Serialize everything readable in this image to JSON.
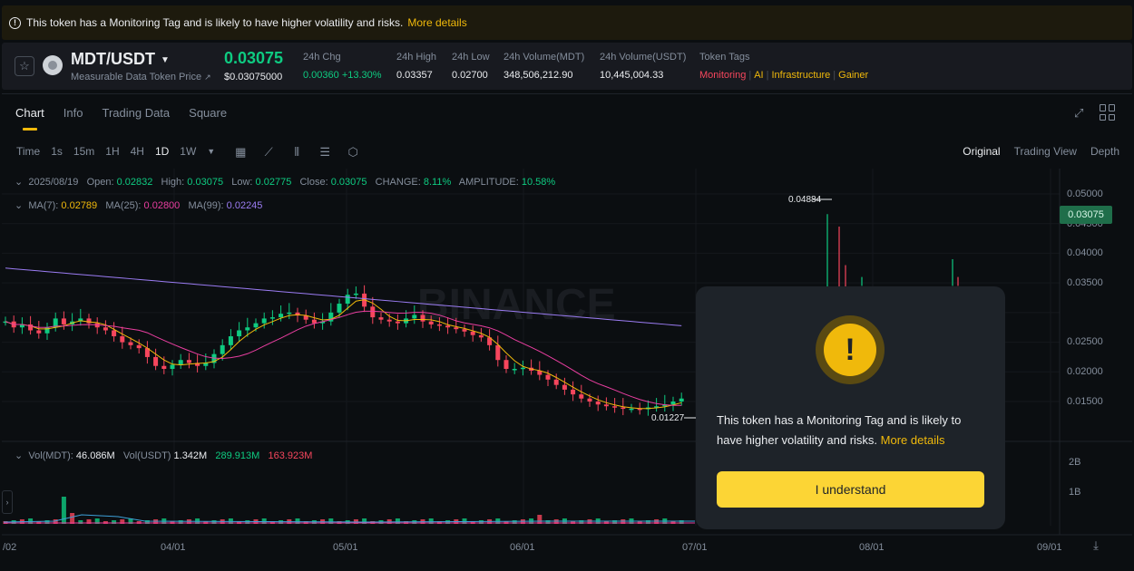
{
  "banner": {
    "icon": "info-icon",
    "text": "This token has a Monitoring Tag and is likely to have higher volatility and risks.",
    "link": "More details"
  },
  "header": {
    "pair": "MDT/USDT",
    "pair_name": "Measurable Data Token Price",
    "price": "0.03075",
    "price_usd": "$0.03075000",
    "stats": [
      {
        "key": "24h Chg",
        "value": "0.00360 +13.30%",
        "up": true
      },
      {
        "key": "24h High",
        "value": "0.03357",
        "up": false
      },
      {
        "key": "24h Low",
        "value": "0.02700",
        "up": false
      },
      {
        "key": "24h Volume(MDT)",
        "value": "348,506,212.90",
        "up": false
      },
      {
        "key": "24h Volume(USDT)",
        "value": "10,445,004.33",
        "up": false
      }
    ],
    "tags_label": "Token Tags",
    "tags": [
      "Monitoring",
      "AI",
      "Infrastructure",
      "Gainer"
    ]
  },
  "tabs": [
    "Chart",
    "Info",
    "Trading Data",
    "Square"
  ],
  "toolbar": {
    "intervals": [
      "Time",
      "1s",
      "15m",
      "1H",
      "4H",
      "1D",
      "1W"
    ],
    "active": "1D",
    "views": [
      "Original",
      "Trading View",
      "Depth"
    ]
  },
  "ohlc": {
    "date": "2025/08/19",
    "open_label": "Open:",
    "open": "0.02832",
    "high_label": "High:",
    "high": "0.03075",
    "low_label": "Low:",
    "low": "0.02775",
    "close_label": "Close:",
    "close": "0.03075",
    "change_label": "CHANGE:",
    "change": "8.11%",
    "amp_label": "AMPLITUDE:",
    "amp": "10.58%"
  },
  "ma": {
    "ma7_label": "MA(7):",
    "ma7": "0.02789",
    "ma25_label": "MA(25):",
    "ma25": "0.02800",
    "ma99_label": "MA(99):",
    "ma99": "0.02245"
  },
  "vol": {
    "mdt_label": "Vol(MDT):",
    "mdt": "46.086M",
    "usdt_label": "Vol(USDT)",
    "usdt": "1.342M",
    "ma1": "289.913M",
    "ma2": "163.923M"
  },
  "chart_data": {
    "type": "candlestick",
    "y_ticks": [
      "0.05000",
      "0.04500",
      "0.04000",
      "0.03500",
      "0.02500",
      "0.02000",
      "0.01500"
    ],
    "x_ticks": [
      "/02",
      "04/01",
      "05/01",
      "06/01",
      "07/01",
      "08/01",
      "09/01"
    ],
    "vol_ticks": [
      "2B",
      "1B"
    ],
    "current_price": "0.03075",
    "high_marker": "0.04884",
    "low_marker": "0.01227",
    "watermark": "BINANCE"
  },
  "modal": {
    "text": "This token has a Monitoring Tag and is likely to have higher volatility and risks.",
    "link": "More details",
    "button": "I understand"
  },
  "colors": {
    "up": "#0ecb81",
    "down": "#f6465d",
    "accent": "#f0b90b"
  }
}
